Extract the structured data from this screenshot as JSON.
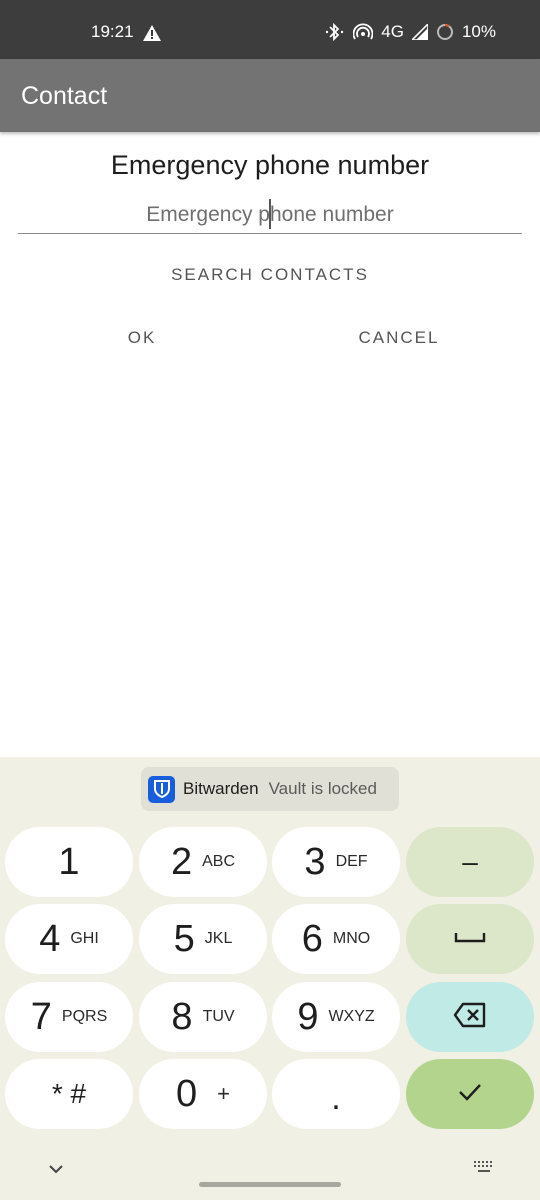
{
  "status_bar": {
    "time": "19:21",
    "network": "4G",
    "battery": "10%"
  },
  "app_bar": {
    "title": "Contact"
  },
  "dialog": {
    "title": "Emergency phone number",
    "input_value": "",
    "input_placeholder": "Emergency phone number",
    "search_label": "SEARCH CONTACTS",
    "ok_label": "OK",
    "cancel_label": "CANCEL"
  },
  "keyboard": {
    "suggestion": {
      "name": "Bitwarden",
      "status": "Vault is locked"
    },
    "rows": [
      {
        "digit": "1",
        "letters": ""
      },
      {
        "digit": "2",
        "letters": "ABC"
      },
      {
        "digit": "3",
        "letters": "DEF"
      },
      {
        "digit": "4",
        "letters": "GHI"
      },
      {
        "digit": "5",
        "letters": "JKL"
      },
      {
        "digit": "6",
        "letters": "MNO"
      },
      {
        "digit": "7",
        "letters": "PQRS"
      },
      {
        "digit": "8",
        "letters": "TUV"
      },
      {
        "digit": "9",
        "letters": "WXYZ"
      }
    ],
    "star_hash": "* #",
    "zero": "0",
    "plus": "+",
    "dot": ".",
    "minus": "–",
    "icons": [
      "space-icon",
      "backspace-icon",
      "check-icon",
      "chevron-down-icon",
      "keyboard-icon"
    ],
    "colors": {
      "background": "#f0f0e4",
      "function_key": "#dce6c8",
      "backspace_key": "#bfeae6",
      "enter_key": "#b3d48c"
    }
  }
}
